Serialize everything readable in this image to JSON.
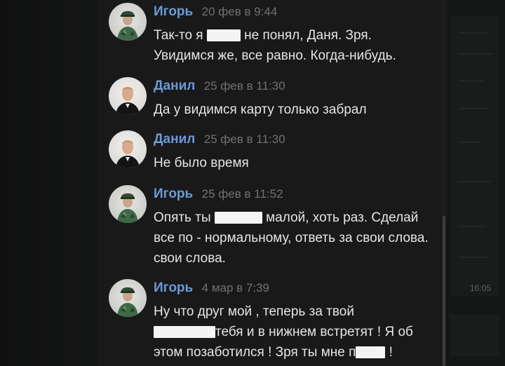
{
  "colors": {
    "author_name": "#6b9ad6",
    "date": "#6f7172",
    "message_text": "#e4e5e6",
    "chat_background": "#19191a"
  },
  "sidebar_right": {
    "time": "16:05"
  },
  "messages": [
    {
      "author": "Игорь",
      "date": "20 фев в 9:44",
      "avatar": "igor-avatar",
      "text_before": "Так-то я",
      "text_after": "не понял, Даня. Зря. Увидимся же, все равно. Когда-нибудь."
    },
    {
      "author": "Данил",
      "date": "25 фев в 11:30",
      "avatar": "danil-avatar",
      "text": "Да у видимся карту только забрал"
    },
    {
      "author": "Данил",
      "date": "25 фев в 11:30",
      "avatar": "danil-avatar",
      "text": "Не было время"
    },
    {
      "author": "Игорь",
      "date": "25 фев в 11:52",
      "avatar": "igor-avatar",
      "text_before": "Опять ты",
      "text_after": "малой, хоть раз. Сделай все по - нормальному, ответь за свои слова. свои слова."
    },
    {
      "author": "Игорь",
      "date": "4 мар в 7:39",
      "avatar": "igor-avatar",
      "line1": "Ну что друг мой , теперь за твой",
      "line2_after": "тебя и в нижнем встретят ! Я об",
      "line3_before": "этом позаботился ! Зря ты мне п",
      "line3_after": "!"
    }
  ]
}
